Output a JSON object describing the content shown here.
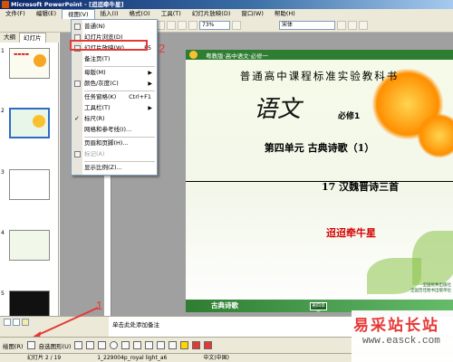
{
  "window": {
    "title": "Microsoft PowerPoint - [迢迢牵牛星]"
  },
  "menubar": [
    "文件(F)",
    "编辑(E)",
    "视图(V)",
    "插入(I)",
    "格式(O)",
    "工具(T)",
    "幻灯片放映(D)",
    "窗口(W)",
    "帮助(H)"
  ],
  "toolbar": {
    "zoom": "73%",
    "font": "宋体"
  },
  "pane_tabs": [
    "大纲",
    "幻灯片"
  ],
  "thumbnails": [
    "1",
    "2",
    "3",
    "4",
    "5"
  ],
  "view_menu": {
    "items": [
      {
        "label": "普通(N)"
      },
      {
        "label": "幻灯片浏览(D)"
      },
      {
        "label": "幻灯片放映(W)",
        "shortcut": "F5"
      },
      {
        "label": "备注页(T)"
      },
      {
        "label": "母版(M)"
      },
      {
        "label": "颜色/灰度(C)"
      },
      {
        "label": "任务窗格(K)",
        "shortcut": "Ctrl+F1"
      },
      {
        "label": "工具栏(T)"
      },
      {
        "label": "标尺(R)"
      },
      {
        "label": "网格和参考线(I)..."
      },
      {
        "label": "页眉和页脚(H)..."
      },
      {
        "label": "标记(A)"
      },
      {
        "label": "显示比例(Z)..."
      }
    ]
  },
  "annotations": {
    "num1": "1",
    "num2": "2"
  },
  "slide": {
    "header": "粤教版·高中语文·必修一",
    "headline": "普通高中课程标准实验教科书",
    "big_title": "语文",
    "volume": "必修1",
    "unit": "第四单元  古典诗歌（1）",
    "lesson": "17  汉魏晋诗三首",
    "poem": "迢迢牵牛星",
    "footer_left": "古典诗歌",
    "footer_box": "第四单元",
    "publisher": "全国优秀出版社\n全国百佳图书出版单位"
  },
  "notes": {
    "placeholder": "单击此处添加备注"
  },
  "drawbar": {
    "draw": "绘图(R)",
    "autoshapes": "自选图形(U)"
  },
  "status": {
    "slide": "幻灯片 2 / 19",
    "template": "1_229004p_royal light_a6",
    "lang": "中文(中国)"
  },
  "watermark": {
    "cn": "易采站长站",
    "url": "www.easck.com"
  }
}
